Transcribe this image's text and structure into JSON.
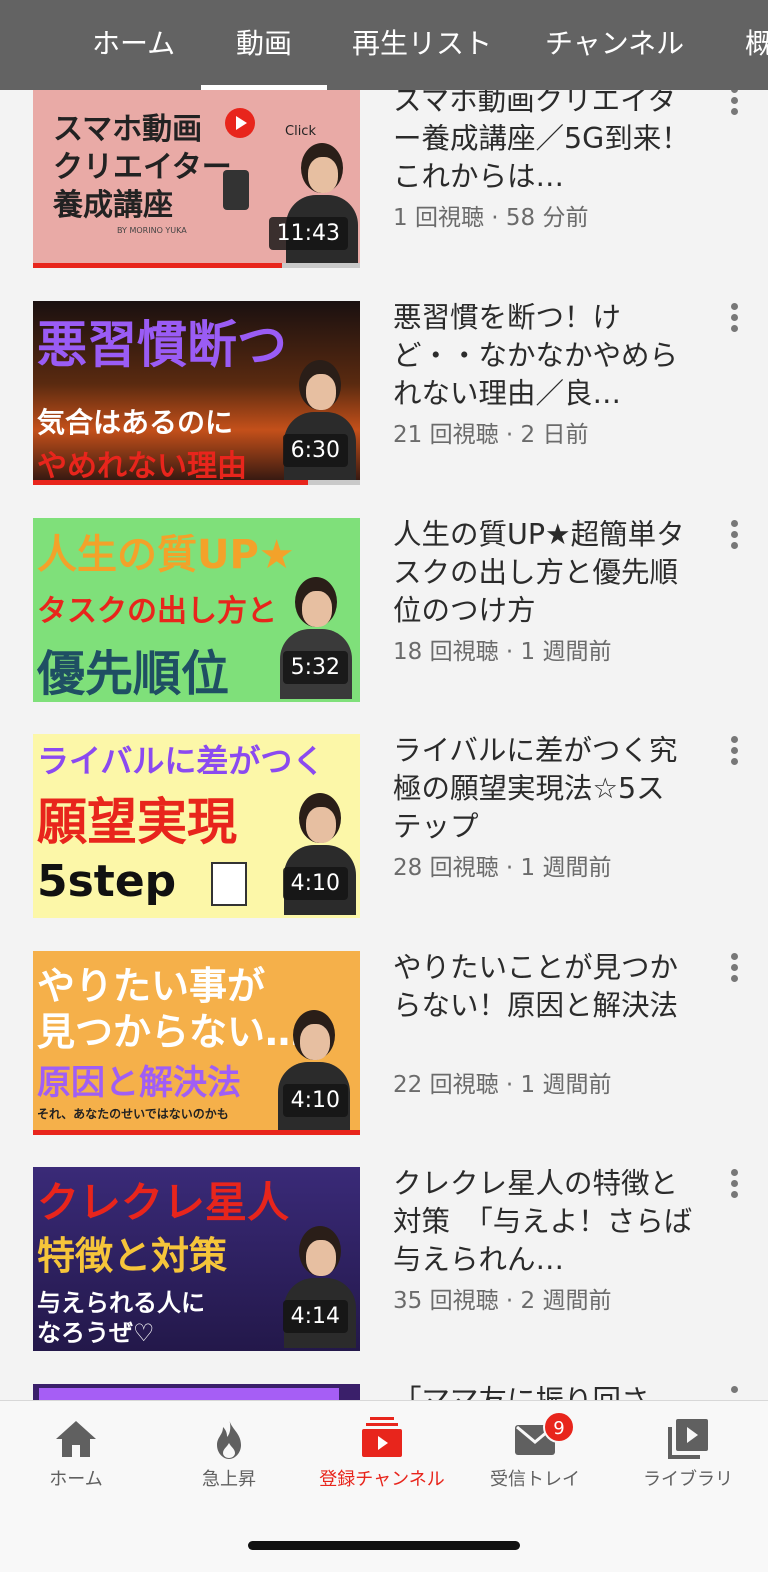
{
  "tabs": {
    "home": "ホーム",
    "videos": "動画",
    "playlists": "再生リスト",
    "channels": "チャンネル",
    "about": "概"
  },
  "videos": [
    {
      "thumb_lines": [
        "スマホ動画",
        "クリエイター",
        "養成講座"
      ],
      "thumb_sub": "BY MORINO YUKA",
      "thumb_extra": "Click",
      "duration": "11:43",
      "progress": 0.76,
      "title": "スマホ動画クリエイター養成講座／5G到来！これからは…",
      "meta": "1 回視聴 · 58 分前"
    },
    {
      "thumb_lines": [
        "悪習慣断つ",
        "気合はあるのに",
        "やめれない理由"
      ],
      "duration": "6:30",
      "progress": 0.84,
      "title": "悪習慣を断つ！けど・・なかなかやめられない理由／良…",
      "meta": "21 回視聴 · 2 日前"
    },
    {
      "thumb_lines": [
        "人生の質UP★",
        "タスクの出し方と",
        "優先順位"
      ],
      "duration": "5:32",
      "progress": 0,
      "title": "人生の質UP★超簡単タスクの出し方と優先順位のつけ方",
      "meta": "18 回視聴 · 1 週間前"
    },
    {
      "thumb_lines": [
        "ライバルに差がつく",
        "願望実現",
        "5step"
      ],
      "duration": "4:10",
      "progress": 0,
      "title": "ライバルに差がつく究極の願望実現法☆5ステップ",
      "meta": "28 回視聴 · 1 週間前"
    },
    {
      "thumb_lines": [
        "やりたい事が",
        "見つからない…",
        "原因と解決法"
      ],
      "thumb_sub": "それ、あなたのせいではないのかも",
      "duration": "4:10",
      "progress": 1.0,
      "title": "やりたいことが見つからない！原因と解決法",
      "meta": "22 回視聴 · 1 週間前"
    },
    {
      "thumb_lines": [
        "クレクレ星人",
        "特徴と対策",
        "与えられる人に",
        "なろうぜ♡"
      ],
      "duration": "4:14",
      "progress": 0,
      "title": "クレクレ星人の特徴と対策　「与えよ！さらば与えられん…",
      "meta": "35 回視聴 · 2 週間前"
    },
    {
      "title": "「ママ友に振り回さ"
    }
  ],
  "bottom_nav": {
    "home": "ホーム",
    "trending": "急上昇",
    "subscriptions": "登録チャンネル",
    "inbox": "受信トレイ",
    "inbox_badge": "9",
    "library": "ライブラリ"
  },
  "colors": {
    "accent": "#e8251c",
    "tabbar": "#636363"
  }
}
